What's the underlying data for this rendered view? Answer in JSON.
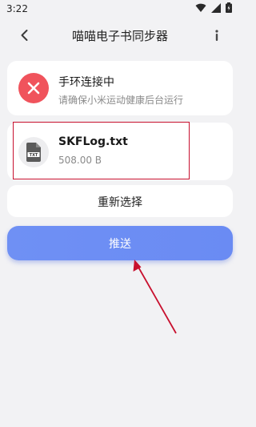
{
  "status_bar": {
    "time": "3:22",
    "icons": [
      "wifi-icon",
      "signal-icon",
      "battery-icon"
    ]
  },
  "app_bar": {
    "title": "喵喵电子书同步器",
    "back_icon": "chevron-left-icon",
    "info_icon": "info-icon"
  },
  "connection_card": {
    "title": "手环连接中",
    "subtitle": "请确保小米运动健康后台运行",
    "icon": "error-x-icon",
    "icon_color": "#f0535c"
  },
  "file_card": {
    "name": "SKFLog.txt",
    "size": "508.00 B",
    "icon": "txt-file-icon"
  },
  "reselect_button": {
    "label": "重新选择"
  },
  "push_button": {
    "label": "推送",
    "color": "#6f90f4"
  },
  "annotation": {
    "highlight_color": "#c8102e"
  }
}
